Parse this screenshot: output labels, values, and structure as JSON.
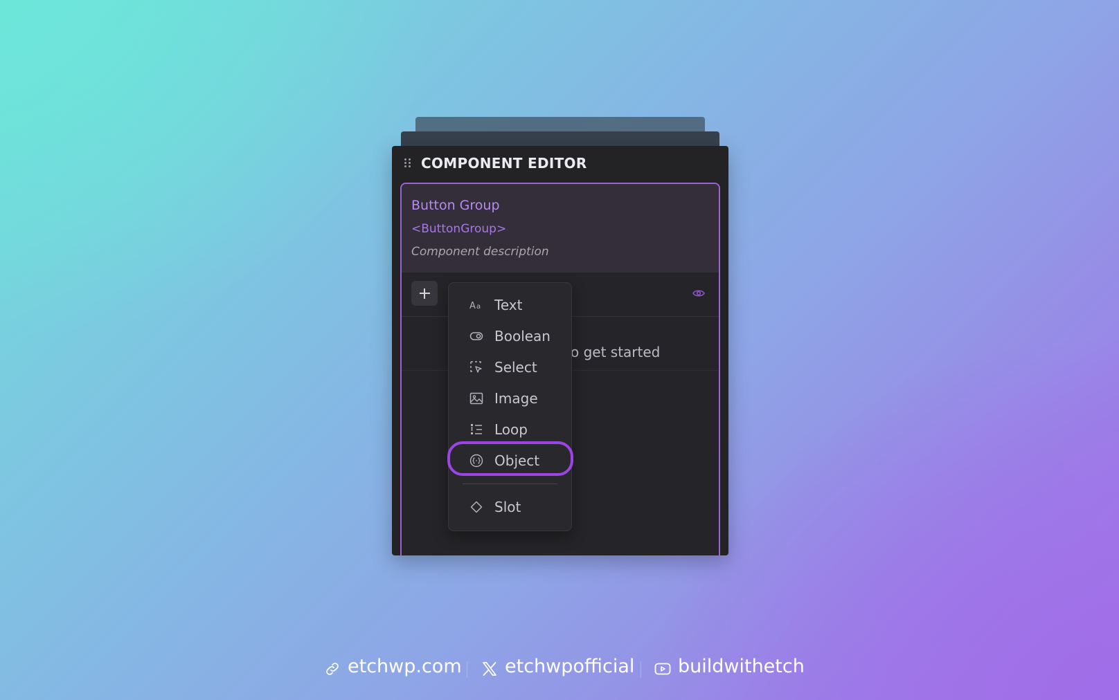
{
  "editor": {
    "title": "COMPONENT EDITOR",
    "component_name": "Button Group",
    "component_tag": "<ButtonGroup>",
    "component_description": "Component description",
    "empty_message": "o get started"
  },
  "menu": {
    "items": [
      {
        "label": "Text",
        "icon": "text-type-icon"
      },
      {
        "label": "Boolean",
        "icon": "toggle-icon"
      },
      {
        "label": "Select",
        "icon": "select-cursor-icon"
      },
      {
        "label": "Image",
        "icon": "image-icon"
      },
      {
        "label": "Loop",
        "icon": "list-loop-icon"
      },
      {
        "label": "Object",
        "icon": "object-braces-icon"
      },
      {
        "label": "Slot",
        "icon": "diamond-icon"
      }
    ],
    "highlighted_item": "Object"
  },
  "footer": {
    "website": "etchwp.com",
    "x_handle": "etchwpofficial",
    "youtube": "buildwithetch"
  },
  "colors": {
    "accent": "#9b45e4",
    "panel_bg": "#232326",
    "component_name": "#b98af0"
  }
}
